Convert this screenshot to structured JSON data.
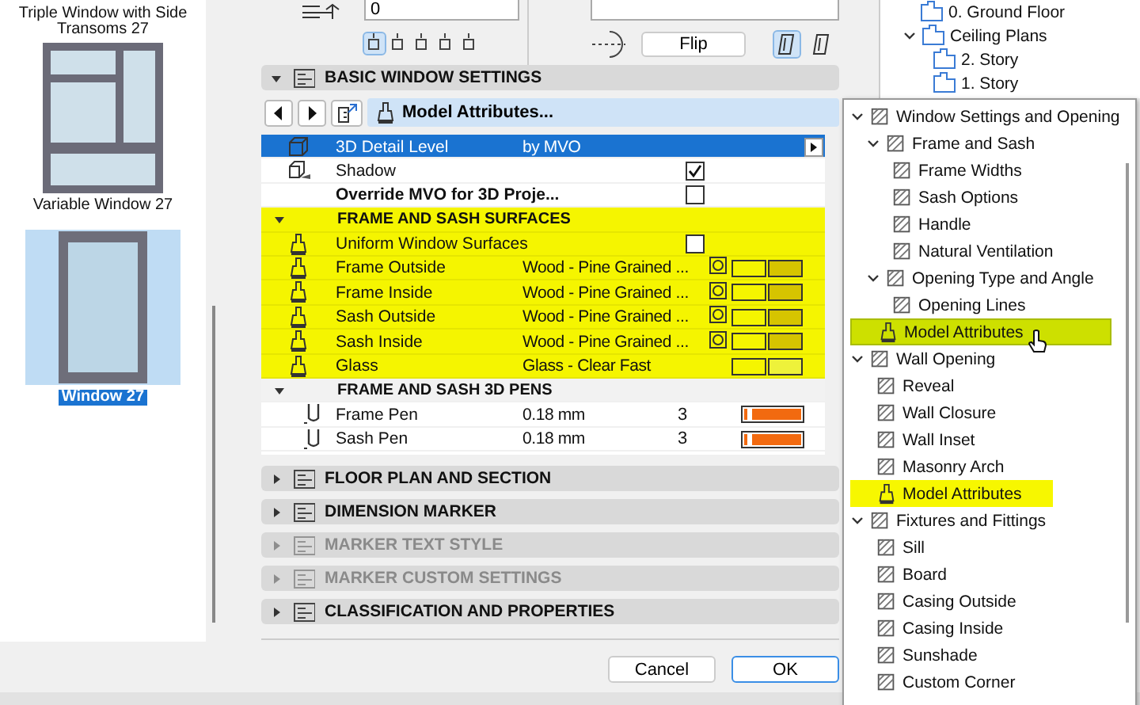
{
  "library": {
    "items": [
      {
        "label": "Triple Window with Side Transoms 27",
        "kind": "label-only",
        "selected": false
      },
      {
        "label": "Variable Window 27",
        "kind": "multi-pane",
        "selected": false
      },
      {
        "label": "Window 27",
        "kind": "single-pane",
        "selected": true
      }
    ]
  },
  "offset_field": {
    "value": "0"
  },
  "anchor_buttons": [
    {
      "selected": true
    },
    {
      "selected": false
    },
    {
      "selected": false
    },
    {
      "selected": false
    },
    {
      "selected": false
    }
  ],
  "flip_button": "Flip",
  "side_toggles": [
    {
      "selected": true
    },
    {
      "selected": false
    }
  ],
  "basic_settings": {
    "title": "BASIC WINDOW SETTINGS",
    "expanded": true,
    "toolbar": {
      "label": "Model Attributes..."
    },
    "rows": [
      {
        "kind": "value",
        "icon": true,
        "label": "3D Detail Level",
        "value": "by MVO",
        "selected": true
      },
      {
        "kind": "check",
        "icon": true,
        "label": "Shadow",
        "checked": true,
        "selected": false
      },
      {
        "kind": "check",
        "icon": false,
        "label": "Override MVO for 3D Proje...",
        "checked": false,
        "selected": false
      }
    ],
    "groups": [
      {
        "title": "FRAME AND SASH SURFACES",
        "expanded": true,
        "highlighted": true,
        "rows": [
          {
            "kind": "check",
            "icon": true,
            "label": "Uniform Window Surfaces",
            "checked": false
          },
          {
            "kind": "surface",
            "label": "Frame Outside",
            "value": "Wood - Pine Grained ...",
            "texture": true,
            "color": "#d6c400"
          },
          {
            "kind": "surface",
            "label": "Frame Inside",
            "value": "Wood - Pine Grained ...",
            "texture": true,
            "color": "#d6c400"
          },
          {
            "kind": "surface",
            "label": "Sash Outside",
            "value": "Wood - Pine Grained ...",
            "texture": true,
            "color": "#d6c400"
          },
          {
            "kind": "surface",
            "label": "Sash Inside",
            "value": "Wood - Pine Grained ...",
            "texture": true,
            "color": "#d6c400"
          },
          {
            "kind": "surface",
            "label": "Glass",
            "value": "Glass - Clear Fast",
            "texture": false,
            "color": "#eef23a"
          }
        ]
      },
      {
        "title": "FRAME AND SASH 3D PENS",
        "expanded": true,
        "highlighted": false,
        "rows": [
          {
            "kind": "pen",
            "label": "Frame Pen",
            "value": "0.18 mm",
            "number": "3",
            "color": "#f26a10"
          },
          {
            "kind": "pen",
            "label": "Sash Pen",
            "value": "0.18 mm",
            "number": "3",
            "color": "#f26a10"
          }
        ]
      }
    ]
  },
  "collapsed_sections": [
    {
      "title": "FLOOR PLAN AND SECTION",
      "expanded": false,
      "disabled": false
    },
    {
      "title": "DIMENSION MARKER",
      "expanded": false,
      "disabled": false
    },
    {
      "title": "MARKER TEXT STYLE",
      "expanded": false,
      "disabled": true
    },
    {
      "title": "MARKER CUSTOM SETTINGS",
      "expanded": false,
      "disabled": true
    },
    {
      "title": "CLASSIFICATION AND PROPERTIES",
      "expanded": false,
      "disabled": false
    }
  ],
  "buttons": [
    {
      "label": "Cancel",
      "default": false
    },
    {
      "label": "OK",
      "default": true
    }
  ],
  "navigator": [
    {
      "label": "0. Ground Floor"
    },
    {
      "label": "Ceiling Plans",
      "expanded": true,
      "children": [
        {
          "label": "2. Story"
        },
        {
          "label": "1. Story"
        }
      ]
    }
  ],
  "popup_menu": [
    {
      "label": "Window Settings and Opening",
      "expanded": true,
      "children": [
        {
          "label": "Frame and Sash",
          "expanded": true,
          "children": [
            {
              "label": "Frame Widths"
            },
            {
              "label": "Sash Options"
            },
            {
              "label": "Handle"
            },
            {
              "label": "Natural Ventilation"
            }
          ]
        },
        {
          "label": "Opening Type and Angle",
          "expanded": true,
          "children": [
            {
              "label": "Opening Lines"
            }
          ]
        },
        {
          "label": "Model Attributes",
          "highlighted": true,
          "hovered": true
        }
      ]
    },
    {
      "label": "Wall Opening",
      "expanded": true,
      "children": [
        {
          "label": "Reveal"
        },
        {
          "label": "Wall Closure"
        },
        {
          "label": "Wall Inset"
        },
        {
          "label": "Masonry Arch"
        },
        {
          "label": "Model Attributes",
          "highlighted": true,
          "hovered": false
        }
      ]
    },
    {
      "label": "Fixtures and Fittings",
      "expanded": true,
      "children": [
        {
          "label": "Sill"
        },
        {
          "label": "Board"
        },
        {
          "label": "Casing Outside"
        },
        {
          "label": "Casing Inside"
        },
        {
          "label": "Sunshade"
        },
        {
          "label": "Custom Corner"
        }
      ]
    }
  ]
}
